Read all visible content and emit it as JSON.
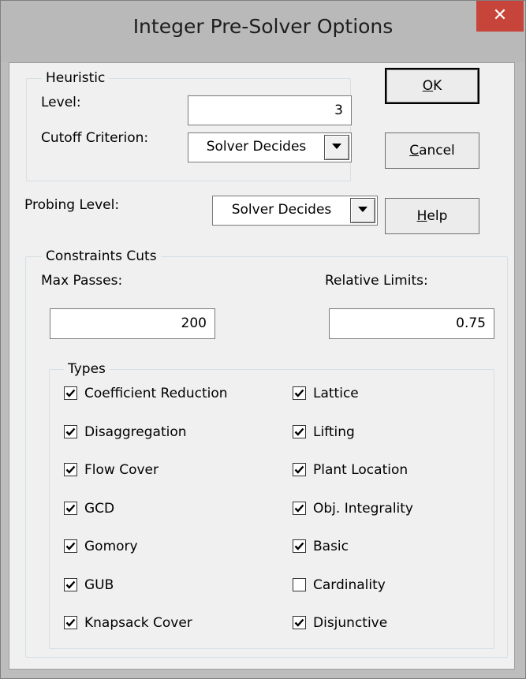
{
  "window": {
    "title": "Integer Pre-Solver Options",
    "close_glyph": "✕"
  },
  "heuristic": {
    "legend": "Heuristic",
    "level_label": "Level:",
    "level_value": "3",
    "cutoff_label": "Cutoff Criterion:",
    "cutoff_value": "Solver Decides"
  },
  "probing": {
    "label": "Probing Level:",
    "value": "Solver Decides"
  },
  "buttons": {
    "ok_prefix": "",
    "ok_mnemonic": "O",
    "ok_rest": "K",
    "cancel_prefix": "",
    "cancel_mnemonic": "C",
    "cancel_rest": "ancel",
    "help_prefix": "",
    "help_mnemonic": "H",
    "help_rest": "elp"
  },
  "constraints_cuts": {
    "legend": "Constraints Cuts",
    "max_passes_label": "Max Passes:",
    "max_passes_value": "200",
    "relative_limits_label": "Relative Limits:",
    "relative_limits_value": "0.75"
  },
  "types": {
    "legend": "Types",
    "left": [
      {
        "label": "Coefficient Reduction",
        "checked": true
      },
      {
        "label": "Disaggregation",
        "checked": true
      },
      {
        "label": "Flow Cover",
        "checked": true
      },
      {
        "label": "GCD",
        "checked": true
      },
      {
        "label": "Gomory",
        "checked": true
      },
      {
        "label": "GUB",
        "checked": true
      },
      {
        "label": "Knapsack Cover",
        "checked": true
      }
    ],
    "right": [
      {
        "label": "Lattice",
        "checked": true
      },
      {
        "label": "Lifting",
        "checked": true
      },
      {
        "label": "Plant Location",
        "checked": true
      },
      {
        "label": "Obj. Integrality",
        "checked": true
      },
      {
        "label": "Basic",
        "checked": true
      },
      {
        "label": "Cardinality",
        "checked": false
      },
      {
        "label": "Disjunctive",
        "checked": true
      }
    ]
  },
  "icons": {
    "dropdown": "chevron-down-icon",
    "close": "close-icon",
    "check": "checkmark-icon"
  },
  "colors": {
    "close_button": "#c7443a",
    "dialog_face": "#f0f0f0",
    "title_bar": "#b9b9b9"
  }
}
